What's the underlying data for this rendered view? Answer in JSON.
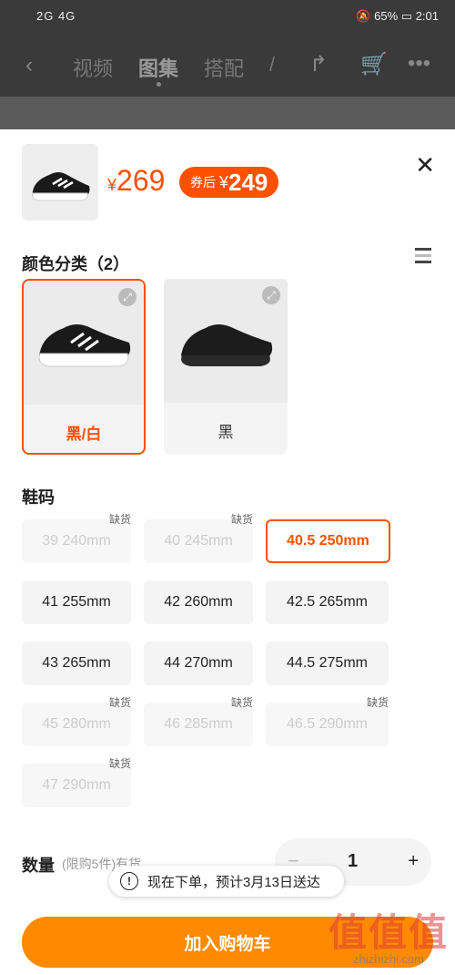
{
  "status_bar": {
    "signal": "2G 4G",
    "battery": "65%",
    "time": "2:01"
  },
  "nav": {
    "tabs": [
      "视频",
      "图集",
      "搭配",
      "/"
    ],
    "active_tab": "图集"
  },
  "product": {
    "currency": "¥",
    "price": "269",
    "coupon_label": "券后",
    "coupon_currency": "¥",
    "coupon_price": "249"
  },
  "color_section": {
    "title": "颜色分类（2）",
    "options": [
      {
        "label": "黑/白",
        "selected": true
      },
      {
        "label": "黑",
        "selected": false
      }
    ]
  },
  "size_section": {
    "title": "鞋码",
    "out_of_stock_label": "缺货",
    "sizes": [
      {
        "label": "39 240mm",
        "state": "disabled"
      },
      {
        "label": "40 245mm",
        "state": "disabled"
      },
      {
        "label": "40.5 250mm",
        "state": "selected"
      },
      {
        "label": "41 255mm",
        "state": "normal"
      },
      {
        "label": "42 260mm",
        "state": "normal"
      },
      {
        "label": "42.5 265mm",
        "state": "normal"
      },
      {
        "label": "43 265mm",
        "state": "normal"
      },
      {
        "label": "44 270mm",
        "state": "normal"
      },
      {
        "label": "44.5 275mm",
        "state": "normal"
      },
      {
        "label": "45 280mm",
        "state": "disabled"
      },
      {
        "label": "46 285mm",
        "state": "disabled"
      },
      {
        "label": "46.5 290mm",
        "state": "disabled"
      },
      {
        "label": "47 290mm",
        "state": "disabled"
      }
    ]
  },
  "quantity": {
    "label": "数量",
    "note": "(限购5件)有货",
    "value": "1",
    "minus": "−",
    "plus": "+"
  },
  "toast": {
    "icon": "!",
    "text": "现在下单，预计3月13日送达"
  },
  "cart_button": {
    "label": "加入购物车"
  },
  "watermark": {
    "big": "值值值",
    "small": "zhizhizhi.com"
  },
  "colors": {
    "accent": "#ff5000",
    "button": "#ff8a00"
  }
}
